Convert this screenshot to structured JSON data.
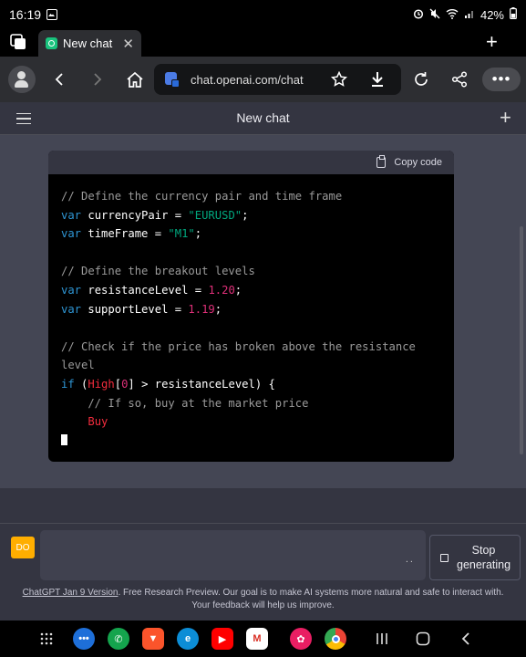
{
  "status": {
    "time": "16:19",
    "battery": "42%"
  },
  "browser": {
    "tab_title": "New chat",
    "url": "chat.openai.com/chat"
  },
  "page": {
    "title": "New chat"
  },
  "code_block": {
    "copy_label": "Copy code",
    "lines": [
      [
        {
          "t": "// Define the currency pair and time frame",
          "c": "cm"
        }
      ],
      [
        {
          "t": "var",
          "c": "kw"
        },
        {
          "t": " currencyPair = ",
          "c": ""
        },
        {
          "t": "\"EURUSD\"",
          "c": "str"
        },
        {
          "t": ";",
          "c": ""
        }
      ],
      [
        {
          "t": "var",
          "c": "kw"
        },
        {
          "t": " timeFrame = ",
          "c": ""
        },
        {
          "t": "\"M1\"",
          "c": "str"
        },
        {
          "t": ";",
          "c": ""
        }
      ],
      [],
      [
        {
          "t": "// Define the breakout levels",
          "c": "cm"
        }
      ],
      [
        {
          "t": "var",
          "c": "kw"
        },
        {
          "t": " resistanceLevel = ",
          "c": ""
        },
        {
          "t": "1.20",
          "c": "num"
        },
        {
          "t": ";",
          "c": ""
        }
      ],
      [
        {
          "t": "var",
          "c": "kw"
        },
        {
          "t": " supportLevel = ",
          "c": ""
        },
        {
          "t": "1.19",
          "c": "num"
        },
        {
          "t": ";",
          "c": ""
        }
      ],
      [],
      [
        {
          "t": "// Check if the price has broken above the resistance",
          "c": "cm"
        }
      ],
      [
        {
          "t": "level",
          "c": "cm"
        }
      ],
      [
        {
          "t": "if",
          "c": "kw"
        },
        {
          "t": " (",
          "c": ""
        },
        {
          "t": "High",
          "c": "fn"
        },
        {
          "t": "[",
          "c": ""
        },
        {
          "t": "0",
          "c": "num"
        },
        {
          "t": "] > resistanceLevel) {",
          "c": ""
        }
      ],
      [
        {
          "t": "    // If so, buy at the market price",
          "c": "cm"
        }
      ],
      [
        {
          "t": "    ",
          "c": ""
        },
        {
          "t": "Buy",
          "c": "fn"
        }
      ]
    ]
  },
  "composer": {
    "avatar_initials": "DO",
    "input_dots": "..",
    "stop_label_1": "Stop",
    "stop_label_2": "generating",
    "footer_link": "ChatGPT Jan 9 Version",
    "footer_text": ". Free Research Preview. Our goal is to make AI systems more natural and safe to interact with. Your feedback will help us improve."
  },
  "colors": {
    "chat_bg": "#444654",
    "header_bg": "#343541",
    "code_bg": "#000000",
    "keyword": "#2e95d3",
    "string": "#00a67d",
    "number": "#df3079",
    "function": "#f22c3d",
    "comment": "#9a9a9a",
    "avatar": "#ffae00"
  },
  "icons": {
    "statusbar": [
      "image-icon",
      "alarm-icon",
      "mute-icon",
      "wifi-icon",
      "signal-icon",
      "battery-icon"
    ],
    "dock": [
      "app-drawer-icon",
      "messages-icon",
      "phone-icon",
      "brave-icon",
      "edge-icon",
      "youtube-icon",
      "gmail-icon",
      "flower-icon",
      "chrome-icon"
    ]
  }
}
